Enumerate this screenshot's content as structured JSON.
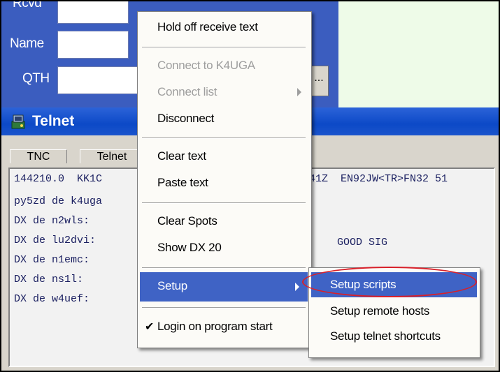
{
  "log_panel": {
    "labels": {
      "rcvd": "Rcvd",
      "name": "Name",
      "qth": "QTH"
    },
    "ellipsis": "..."
  },
  "telnet": {
    "title": "Telnet",
    "tabs": [
      "TNC",
      "Telnet"
    ],
    "lines": [
      {
        "left": "144210.0  KK1C",
        "right": "41Z  EN92JW<TR>FN32 51"
      },
      {
        "left": "py5zd de k4uga",
        "right": ""
      },
      {
        "left": "DX de n2wls:",
        "right": ""
      },
      {
        "left": "DX de lu2dvi:",
        "right": "GOOD SIG"
      },
      {
        "left": "DX de n1emc:",
        "right": ""
      },
      {
        "left": "DX de ns1l:",
        "right": ""
      },
      {
        "left": "DX de w4uef:",
        "right": ""
      }
    ]
  },
  "menu": {
    "hold_off": "Hold off receive text",
    "connect_to": "Connect to K4UGA",
    "connect_list": "Connect list",
    "disconnect": "Disconnect",
    "clear_text": "Clear text",
    "paste_text": "Paste text",
    "clear_spots": "Clear Spots",
    "show_dx": "Show DX 20",
    "setup": "Setup",
    "login": "Login on program start",
    "login_checked": true
  },
  "submenu": {
    "items": [
      "Setup scripts",
      "Setup remote hosts",
      "Setup telnet shortcuts"
    ],
    "highlighted": "Setup scripts"
  },
  "colors": {
    "panel_blue": "#3b5dbf",
    "title_blue": "#0c49c7",
    "highlight": "#3f63c5",
    "annotation_red": "#d8202a"
  }
}
